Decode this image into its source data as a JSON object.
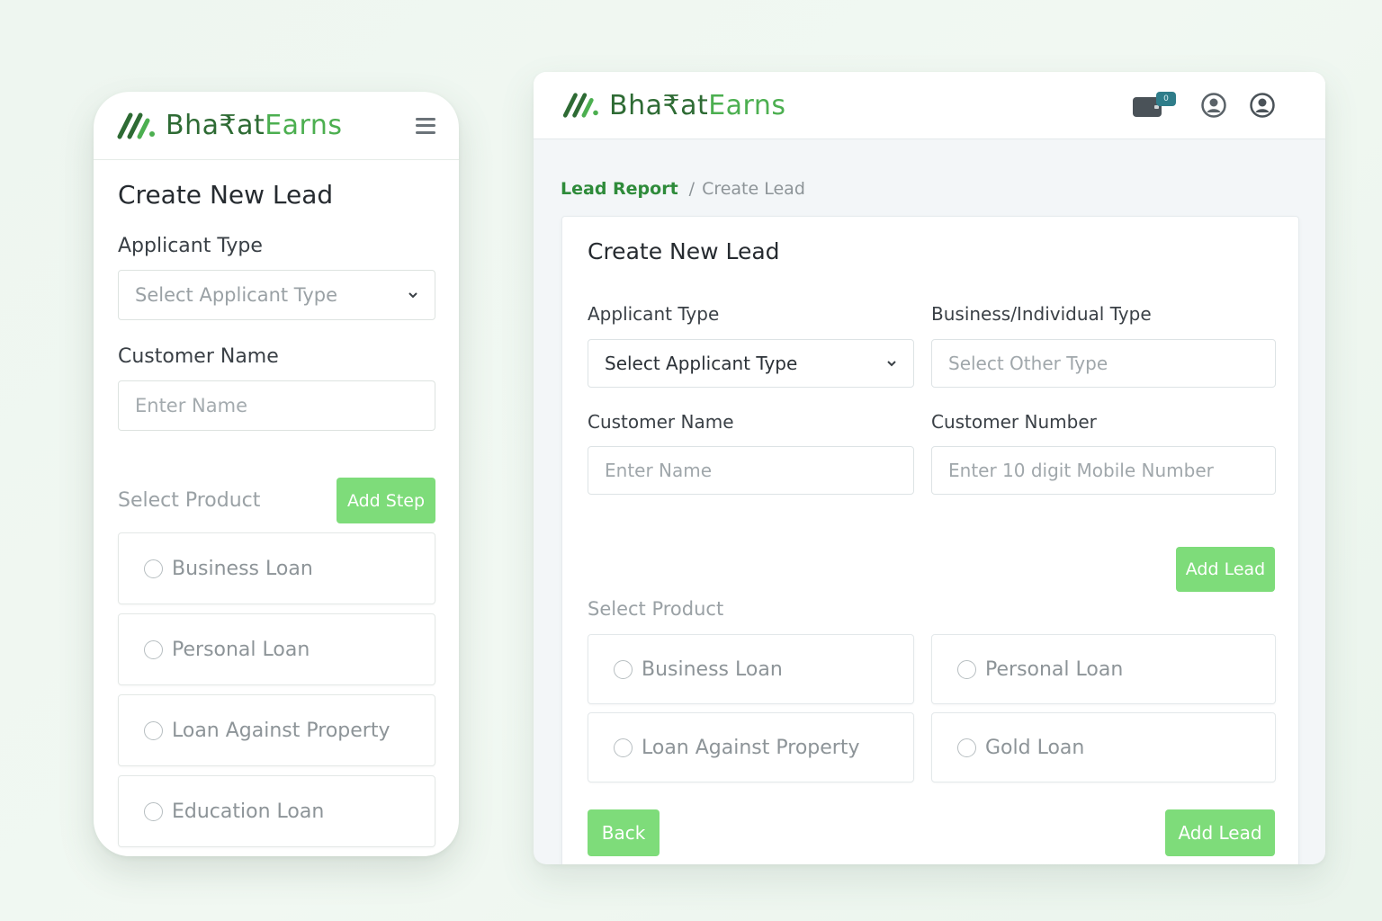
{
  "brand": {
    "part1": "Bha₹at",
    "part2": "Earns"
  },
  "mobile": {
    "title": "Create New Lead",
    "applicant_type_label": "Applicant Type",
    "applicant_type_placeholder": "Select Applicant Type",
    "customer_name_label": "Customer Name",
    "customer_name_placeholder": "Enter Name",
    "select_product_label": "Select Product",
    "add_step_label": "Add Step",
    "products": [
      "Business Loan",
      "Personal Loan",
      "Loan Against Property",
      "Education Loan"
    ]
  },
  "desktop": {
    "wallet_badge": "0",
    "breadcrumb": {
      "link": "Lead Report",
      "separator": "/",
      "current": "Create Lead"
    },
    "title": "Create New Lead",
    "applicant_type_label": "Applicant Type",
    "applicant_type_value": "Select Applicant Type",
    "business_type_label": "Business/Individual Type",
    "business_type_placeholder": "Select Other Type",
    "customer_name_label": "Customer Name",
    "customer_name_placeholder": "Enter Name",
    "customer_number_label": "Customer Number",
    "customer_number_placeholder": "Enter 10 digit Mobile Number",
    "add_lead_label": "Add Lead",
    "select_product_label": "Select Product",
    "products": [
      "Business Loan",
      "Personal Loan",
      "Loan Against Property",
      "Gold Loan"
    ],
    "back_label": "Back",
    "add_lead_bottom_label": "Add Lead"
  },
  "colors": {
    "brand_dark": "#2e6b34",
    "brand_light": "#4caf50",
    "button_green": "#7edc7a",
    "link_green": "#2e8b3a"
  },
  "icons": [
    "logo-slash-icon",
    "hamburger-icon",
    "chevron-down-icon",
    "wallet-icon",
    "user-circle-icon",
    "radio-icon"
  ]
}
